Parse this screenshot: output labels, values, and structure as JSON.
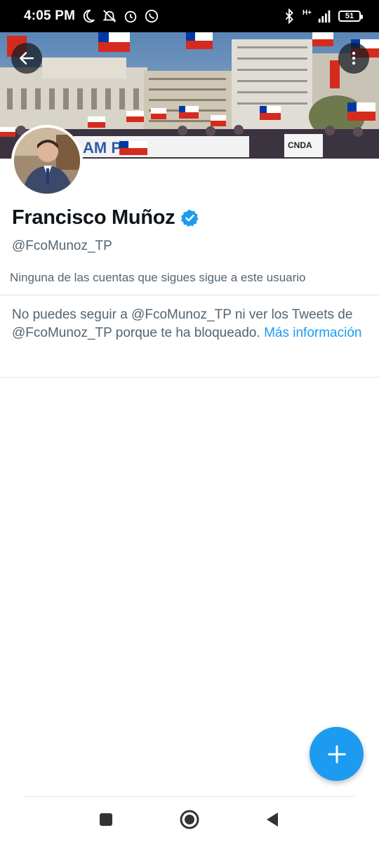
{
  "status_bar": {
    "time": "4:05 PM",
    "network": "H+",
    "battery": "51",
    "icons": [
      "moon-icon",
      "notifications-off-icon",
      "alarm-icon",
      "whatsapp-icon",
      "bluetooth-icon",
      "signal-icon"
    ]
  },
  "banner": {
    "sign_left": "AM PA",
    "sign_right": "CNDA"
  },
  "profile": {
    "display_name": "Francisco Muñoz",
    "handle": "@FcoMunoz_TP",
    "follow_note": "Ninguna de las cuentas que sigues sigue a este usuario",
    "verified_color": "#1d9bf0"
  },
  "blocked": {
    "message": "No puedes seguir a @FcoMunoz_TP ni ver los Tweets de @FcoMunoz_TP porque te ha bloqueado.",
    "link_text": "Más información"
  },
  "colors": {
    "accent": "#1d9bf0",
    "secondary_text": "#536471",
    "primary_text": "#0f1419"
  }
}
